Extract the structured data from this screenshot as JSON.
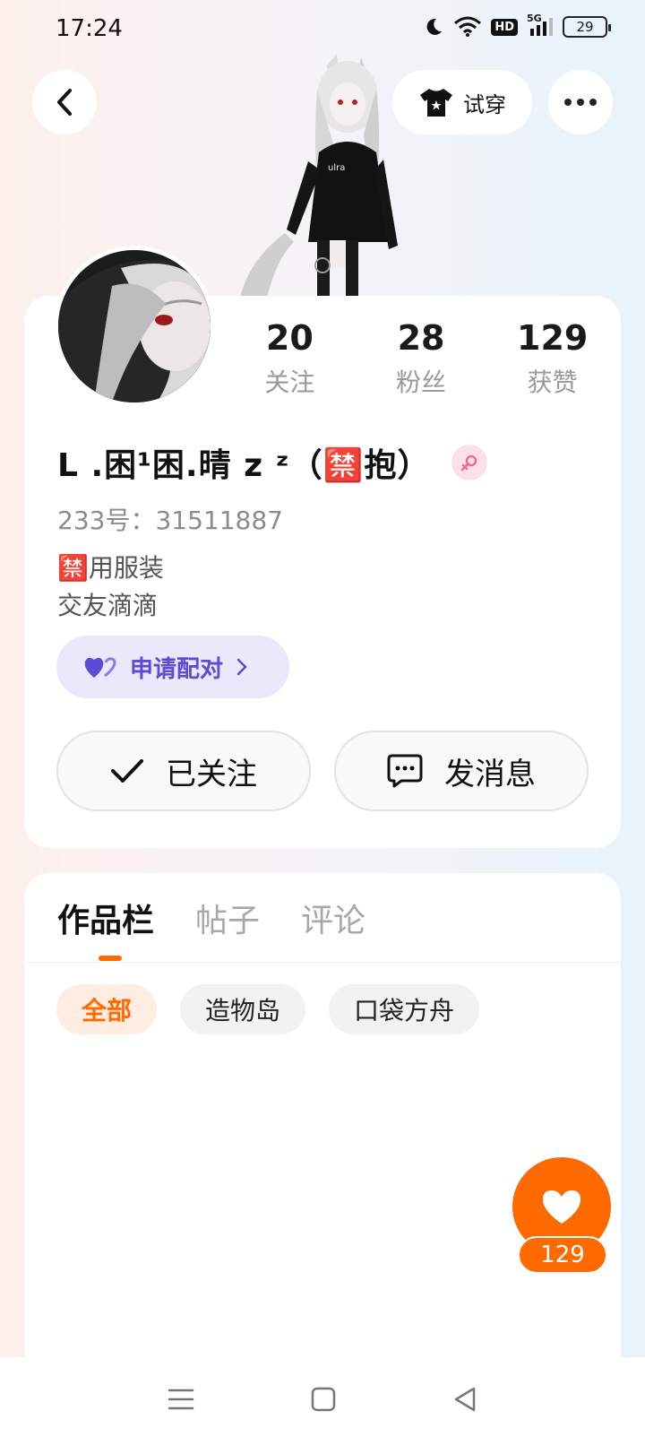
{
  "status_bar": {
    "time": "17:24",
    "network": "5G",
    "hd": "HD",
    "battery": "29",
    "icons": [
      "moon-icon",
      "wifi-icon",
      "hd-icon",
      "signal-icon",
      "battery-icon"
    ]
  },
  "header": {
    "try_on_label": "试穿",
    "icons": [
      "back-icon",
      "tshirt-icon",
      "more-icon"
    ]
  },
  "profile": {
    "stats": [
      {
        "value": "20",
        "label": "关注"
      },
      {
        "value": "28",
        "label": "粉丝"
      },
      {
        "value": "129",
        "label": "获赞"
      }
    ],
    "username": "L .困¹困.晴 z ᶻ（🈲抱）",
    "uid": "233号：31511887",
    "bio_lines": [
      "🈲用服装",
      "交友滴滴"
    ],
    "pair_label": "申请配对",
    "follow_label": "已关注",
    "message_label": "发消息"
  },
  "works": {
    "tabs": [
      "作品栏",
      "帖子",
      "评论"
    ],
    "active_tab": 0,
    "filters": [
      "全部",
      "造物岛",
      "口袋方舟"
    ],
    "active_filter": 0
  },
  "like_fab": {
    "count": "129"
  },
  "colors": {
    "accent": "#ff6a00",
    "pair": "#5b4bd6",
    "pair_bg": "#eae8fb",
    "gender": "#f06a98"
  }
}
